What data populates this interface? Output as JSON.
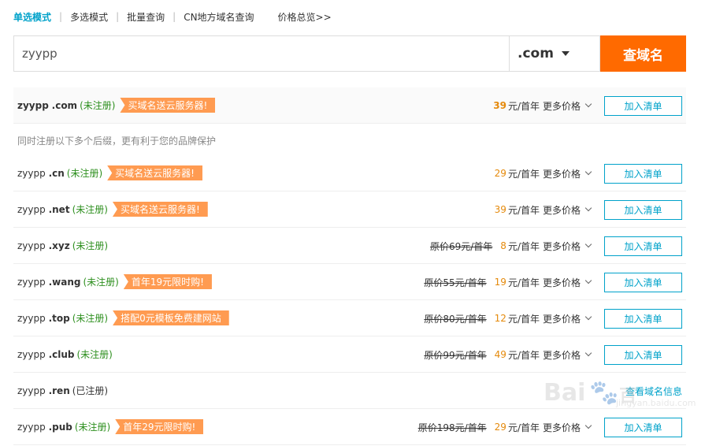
{
  "tabs": [
    {
      "label": "单选模式"
    },
    {
      "label": "多选模式"
    },
    {
      "label": "批量查询"
    },
    {
      "label": "CN地方域名查询"
    }
  ],
  "price_overview": "价格总览>>",
  "tab_separator": "|",
  "search": {
    "value": "zyypp",
    "suffix": ".com",
    "button": "查域名"
  },
  "main_row": {
    "name": "zyypp",
    "suffix": ".com",
    "status": "(未注册)",
    "promo": "买域名送云服务器!",
    "price": "39",
    "unit": "元/首年",
    "more": "更多价格",
    "add": "加入清单"
  },
  "hint": "同时注册以下多个后缀，更有利于您的品牌保护",
  "rows": [
    {
      "name": "zyypp",
      "suffix": ".cn",
      "status": "(未注册)",
      "promo": "买域名送云服务器!",
      "orig": "",
      "price": "29",
      "unit": "元/首年",
      "more": "更多价格",
      "add": "加入清单"
    },
    {
      "name": "zyypp",
      "suffix": ".net",
      "status": "(未注册)",
      "promo": "买域名送云服务器!",
      "orig": "",
      "price": "39",
      "unit": "元/首年",
      "more": "更多价格",
      "add": "加入清单"
    },
    {
      "name": "zyypp",
      "suffix": ".xyz",
      "status": "(未注册)",
      "promo": "",
      "orig": "原价69元/首年",
      "price": "8",
      "unit": "元/首年",
      "more": "更多价格",
      "add": "加入清单"
    },
    {
      "name": "zyypp",
      "suffix": ".wang",
      "status": "(未注册)",
      "promo": "首年19元限时购!",
      "orig": "原价55元/首年",
      "price": "19",
      "unit": "元/首年",
      "more": "更多价格",
      "add": "加入清单"
    },
    {
      "name": "zyypp",
      "suffix": ".top",
      "status": "(未注册)",
      "promo": "搭配0元模板免费建网站",
      "orig": "原价80元/首年",
      "price": "12",
      "unit": "元/首年",
      "more": "更多价格",
      "add": "加入清单"
    },
    {
      "name": "zyypp",
      "suffix": ".club",
      "status": "(未注册)",
      "promo": "",
      "orig": "原价99元/首年",
      "price": "49",
      "unit": "元/首年",
      "more": "更多价格",
      "add": "加入清单"
    },
    {
      "name": "zyypp",
      "suffix": ".ren",
      "status": "(已注册)",
      "registered": true,
      "whois": "查看域名信息"
    },
    {
      "name": "zyypp",
      "suffix": ".pub",
      "status": "(未注册)",
      "promo": "首年29元限时购!",
      "orig": "原价198元/首年",
      "price": "29",
      "unit": "元/首年",
      "more": "更多价格",
      "add": "加入清单"
    }
  ],
  "watermark": {
    "text": "Bai",
    "text2": "百",
    "sub": "jingyan.baidu.com"
  },
  "colors": {
    "accent": "#00a2ca",
    "orange": "#ff6a00",
    "promo": "#ff9b51",
    "price": "#e58a0c",
    "status_green": "#2d8f1e"
  }
}
